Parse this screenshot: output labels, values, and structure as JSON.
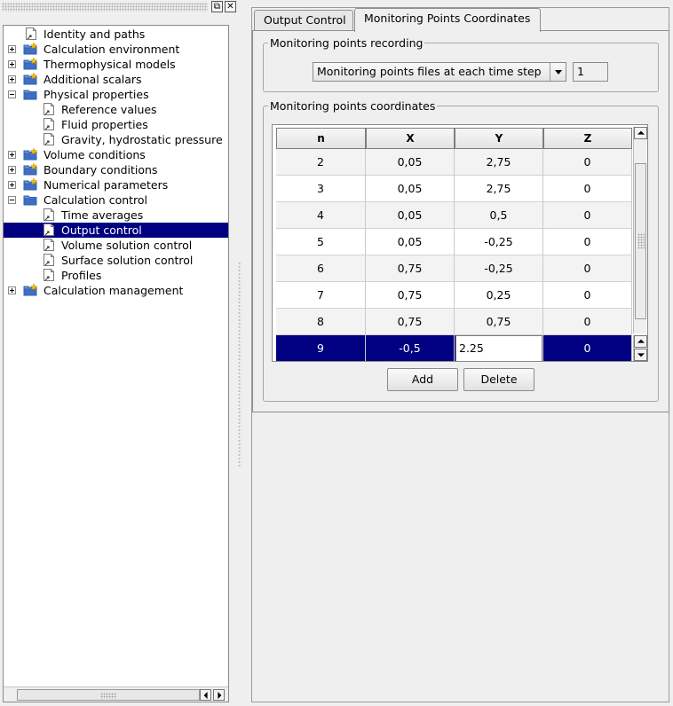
{
  "tree": {
    "items": [
      {
        "label": "Identity and paths",
        "type": "file",
        "level": 0
      },
      {
        "label": "Calculation environment",
        "type": "folder-plus",
        "level": 0
      },
      {
        "label": "Thermophysical models",
        "type": "folder-plus",
        "level": 0
      },
      {
        "label": "Additional scalars",
        "type": "folder-plus",
        "level": 0
      },
      {
        "label": "Physical properties",
        "type": "folder-minus",
        "level": 0
      },
      {
        "label": "Reference values",
        "type": "file",
        "level": 1
      },
      {
        "label": "Fluid properties",
        "type": "file",
        "level": 1
      },
      {
        "label": "Gravity, hydrostatic pressure",
        "type": "file",
        "level": 1
      },
      {
        "label": "Volume conditions",
        "type": "folder-plus",
        "level": 0
      },
      {
        "label": "Boundary conditions",
        "type": "folder-plus",
        "level": 0
      },
      {
        "label": "Numerical parameters",
        "type": "folder-plus",
        "level": 0
      },
      {
        "label": "Calculation control",
        "type": "folder-minus",
        "level": 0
      },
      {
        "label": "Time averages",
        "type": "file",
        "level": 1
      },
      {
        "label": "Output control",
        "type": "file",
        "level": 1,
        "selected": true
      },
      {
        "label": "Volume solution control",
        "type": "file",
        "level": 1
      },
      {
        "label": "Surface solution control",
        "type": "file",
        "level": 1
      },
      {
        "label": "Profiles",
        "type": "file",
        "level": 1
      },
      {
        "label": "Calculation management",
        "type": "folder-plus",
        "level": 0
      }
    ]
  },
  "tabs": [
    {
      "label": "Output Control",
      "active": false
    },
    {
      "label": "Monitoring Points Coordinates",
      "active": true
    }
  ],
  "recording": {
    "title": "Monitoring points recording",
    "mode": "Monitoring points files at each time step",
    "frequency": "1"
  },
  "coordinates": {
    "title": "Monitoring points coordinates",
    "headers": [
      "n",
      "X",
      "Y",
      "Z"
    ],
    "rows": [
      [
        "2",
        "0,05",
        "2,75",
        "0"
      ],
      [
        "3",
        "0,05",
        "2,75",
        "0"
      ],
      [
        "4",
        "0,05",
        "0,5",
        "0"
      ],
      [
        "5",
        "0,05",
        "-0,25",
        "0"
      ],
      [
        "6",
        "0,75",
        "-0,25",
        "0"
      ],
      [
        "7",
        "0,75",
        "0,25",
        "0"
      ],
      [
        "8",
        "0,75",
        "0,75",
        "0"
      ]
    ],
    "selected_row": [
      "9",
      "-0,5",
      "2.25",
      "0"
    ],
    "add_label": "Add",
    "delete_label": "Delete"
  },
  "colors": {
    "selection": "#000080",
    "folder": "#2f5fb0",
    "folder_star": "#f2c200"
  }
}
